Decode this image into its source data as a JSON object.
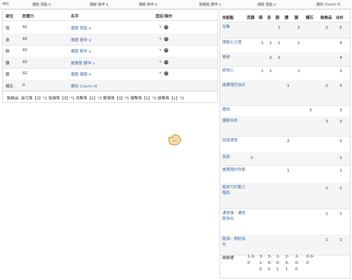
{
  "topbar": {
    "value": "460",
    "items": [
      "攜龍 頭盔 α",
      "攜龍 鎧甲 α",
      "攜龍 腕甲 α",
      "麗賽龍 腰甲 γ",
      "攜龍 護腿 α",
      "攤術 Charm III"
    ]
  },
  "equipment": {
    "headers": [
      "部位",
      "防禦力",
      "名字",
      "固定/除外"
    ],
    "rows": [
      {
        "slot": "頭",
        "defense": "92",
        "name": "攜龍 頭盔 α"
      },
      {
        "slot": "身",
        "defense": "92",
        "name": "攜龍 鎧甲 α"
      },
      {
        "slot": "腕",
        "defense": "92",
        "name": "攜龍 腕甲 α"
      },
      {
        "slot": "腰",
        "defense": "92",
        "name": "麗賽龍 腰甲 γ"
      },
      {
        "slot": "腳",
        "defense": "92",
        "name": "攜龍 護腿 α"
      },
      {
        "slot": "護石",
        "defense": "0",
        "name": "攤術 Charm III"
      }
    ],
    "accessory_label": "裝飾品",
    "accessory_text": "強弓珠【2】*1 強彈珠【3】*1 攻擊珠【1】*2 散彈珠【3】*1 爆擊珠【1】*2 破擊珠【1】*2"
  },
  "skills": {
    "headers": [
      "技能點",
      "武器",
      "頭",
      "身",
      "腕",
      "腰",
      "腳",
      "護石",
      "裝飾品",
      "合計"
    ],
    "rows": [
      {
        "name": "攻擊",
        "cells": [
          "",
          "",
          "",
          "1",
          "",
          "2",
          "",
          "2",
          "5"
        ]
      },
      {
        "name": "龍騎士之證",
        "cells": [
          "",
          "1",
          "1",
          "1",
          "",
          "1",
          "",
          "",
          "4"
        ]
      },
      {
        "name": "看破",
        "cells": [
          "",
          "",
          "2",
          "2",
          "",
          "",
          "",
          "",
          "4"
        ]
      },
      {
        "name": "超會心",
        "cells": [
          "",
          "1",
          "1",
          "",
          "",
          "1",
          "",
          "",
          "3"
        ]
      },
      {
        "name": "麗賽龍性強化",
        "cells": [
          "",
          "",
          "",
          "",
          "1",
          "",
          "",
          "2",
          "3"
        ]
      },
      {
        "name": "體術",
        "cells": [
          "",
          "",
          "",
          "",
          "",
          "",
          "3",
          "",
          "3"
        ]
      },
      {
        "name": "擴散特效",
        "cells": [
          "",
          "",
          "",
          "",
          "",
          "",
          "",
          "3",
          "3"
        ]
      },
      {
        "name": "回復速度",
        "cells": [
          "",
          "",
          "",
          "",
          "2",
          "",
          "",
          "",
          "2"
        ]
      },
      {
        "name": "飛燕",
        "cells": [
          "1",
          "",
          "",
          "",
          "",
          "",
          "",
          "",
          "1"
        ]
      },
      {
        "name": "麗賽龍的命脈",
        "cells": [
          "",
          "",
          "",
          "",
          "1",
          "",
          "",
          "",
          "1"
        ]
      },
      {
        "name": "解放弓的蓄力階段",
        "cells": [
          "",
          "",
          "",
          "",
          "",
          "",
          "",
          "1",
          "1"
        ]
      },
      {
        "name": "通常彈・通常箭強化",
        "cells": [
          "",
          "",
          "",
          "",
          "",
          "",
          "",
          "1",
          "1"
        ]
      },
      {
        "name": "散彈・剛射強化",
        "cells": [
          "",
          "",
          "",
          "",
          "",
          "",
          "",
          "1",
          "1"
        ]
      }
    ],
    "slots_label": "鑲嵌槽",
    "slots": [
      [
        "1-0-",
        "0"
      ],
      [
        "3-",
        "1-",
        "0"
      ],
      [
        "3-",
        "0-",
        "0"
      ],
      [
        "2-",
        "0-",
        "1"
      ],
      [
        "2-",
        "0-",
        "1"
      ],
      [
        "2-",
        "0-",
        "0"
      ],
      [
        "0-0-",
        "0"
      ]
    ]
  }
}
